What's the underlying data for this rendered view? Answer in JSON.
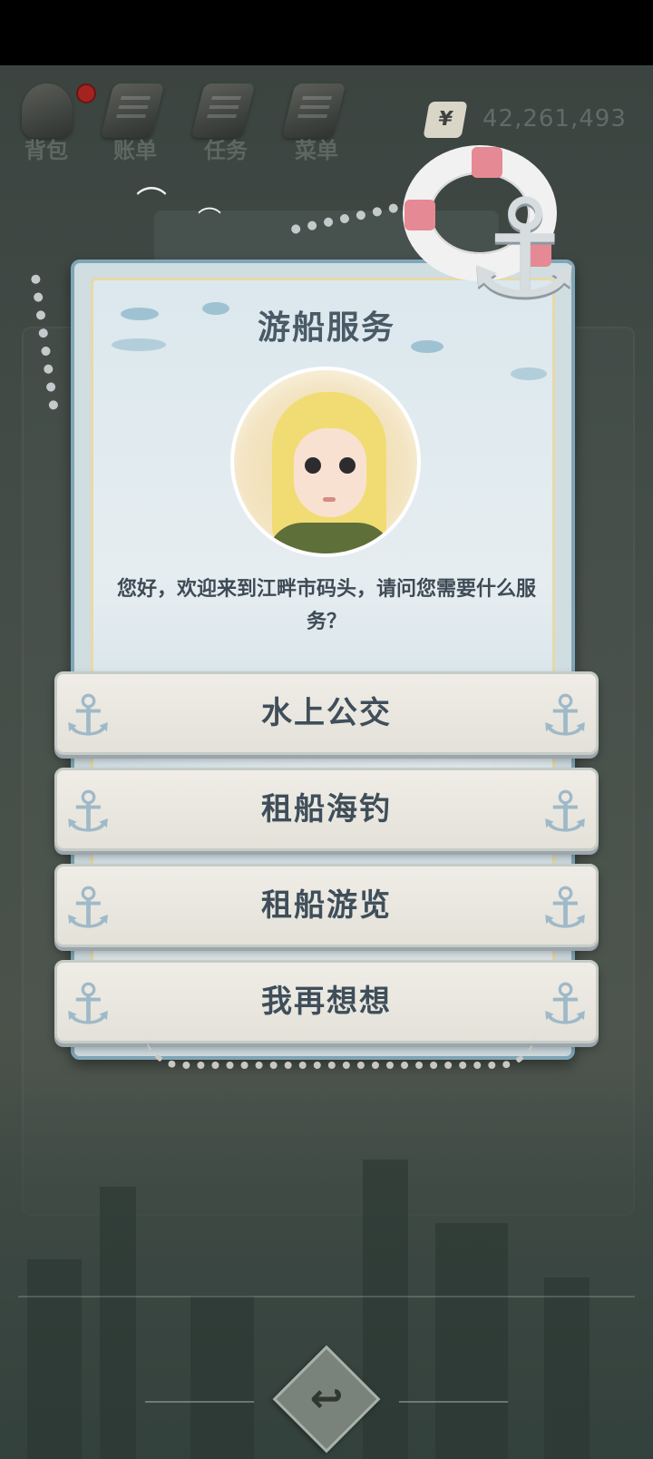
{
  "top_nav": {
    "items": [
      {
        "label": "背包",
        "icon": "bag-icon"
      },
      {
        "label": "账单",
        "icon": "bill-icon"
      },
      {
        "label": "任务",
        "icon": "task-icon"
      },
      {
        "label": "菜单",
        "icon": "menu-icon"
      }
    ],
    "notification_dot_color": "#a3241f"
  },
  "currency": {
    "symbol": "¥",
    "amount": "42,261,493"
  },
  "dialog": {
    "title": "游船服务",
    "avatar": "character-portrait",
    "greeting": "您好，欢迎来到江畔市码头，请问您需要什么服务？",
    "options": [
      {
        "label": "水上公交"
      },
      {
        "label": "租船海钓"
      },
      {
        "label": "租船游览"
      },
      {
        "label": "我再想想"
      }
    ]
  },
  "colors": {
    "panel_border": "#7fa6b7",
    "option_text": "#3f4e5a",
    "title_text": "#4a5a66"
  }
}
